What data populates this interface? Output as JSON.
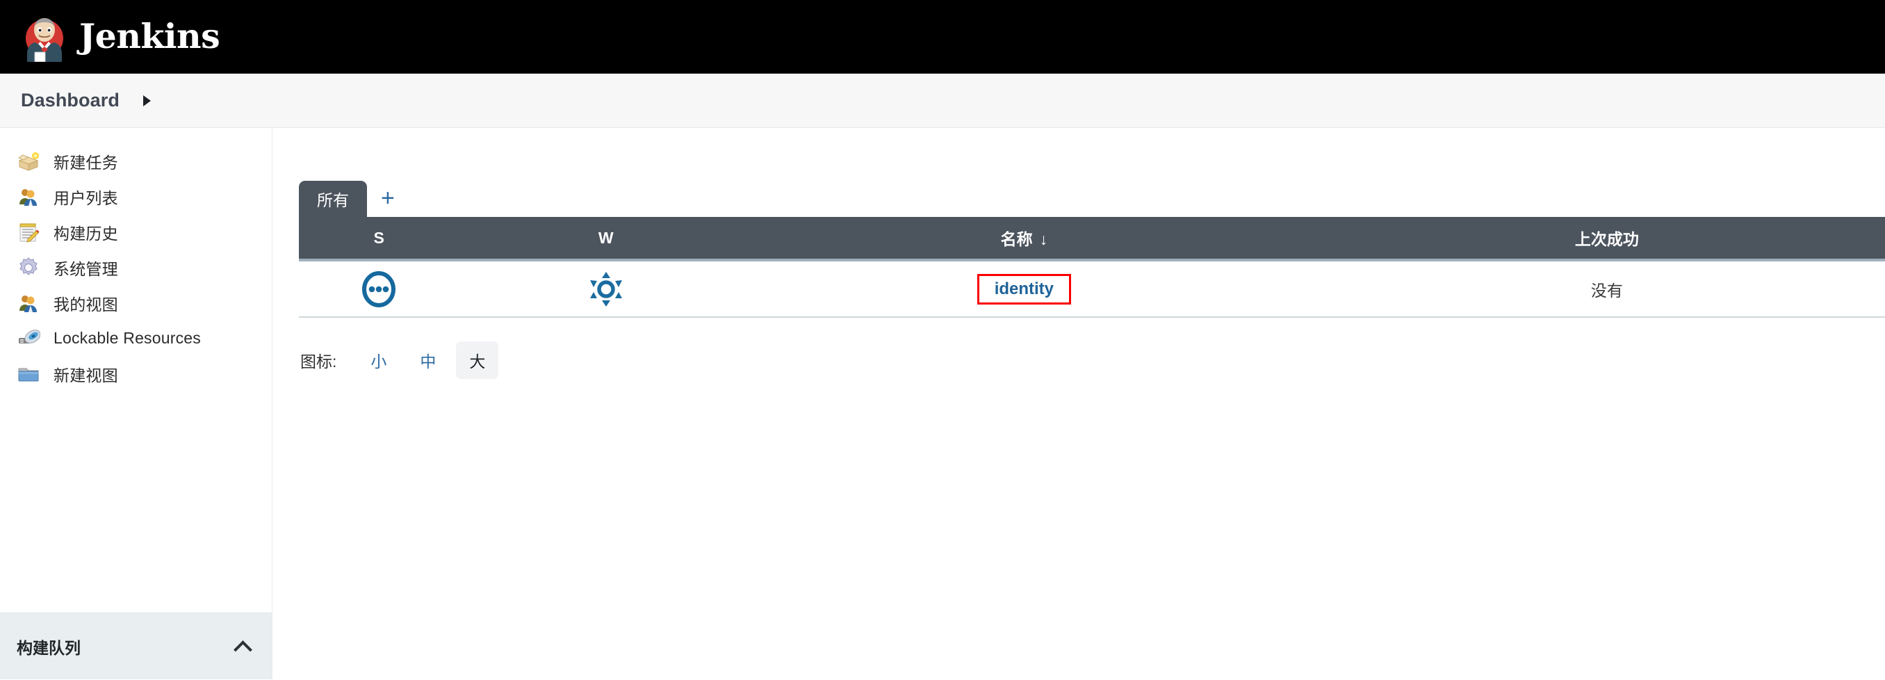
{
  "masthead": {
    "title": "Jenkins",
    "logo_icon": "jenkins-butler-icon"
  },
  "breadcrumb": {
    "items": [
      {
        "label": "Dashboard"
      }
    ],
    "caret_icon": "caret-right-icon"
  },
  "sidebar": {
    "items": [
      {
        "label": "新建任务",
        "icon": "new-job-box-icon"
      },
      {
        "label": "用户列表",
        "icon": "users-icon"
      },
      {
        "label": "构建历史",
        "icon": "build-history-notepad-icon"
      },
      {
        "label": "系统管理",
        "icon": "gear-icon"
      },
      {
        "label": "我的视图",
        "icon": "my-views-people-icon"
      },
      {
        "label": "Lockable Resources",
        "icon": "usb-device-icon"
      },
      {
        "label": "新建视图",
        "icon": "folder-icon"
      }
    ],
    "queue": {
      "title": "构建队列",
      "chevron_icon": "chevron-up-icon"
    }
  },
  "main": {
    "tabs": [
      {
        "label": "所有",
        "active": true
      }
    ],
    "add_tab_label": "+",
    "table": {
      "columns": [
        {
          "key": "s",
          "label": "S"
        },
        {
          "key": "w",
          "label": "W"
        },
        {
          "key": "name",
          "label": "名称",
          "sort_indicator": "↓"
        },
        {
          "key": "last_success",
          "label": "上次成功"
        }
      ],
      "rows": [
        {
          "status_icon": "status-pending-dots-icon",
          "weather_icon": "weather-sunny-icon",
          "name": "identity",
          "name_highlighted": true,
          "last_success": "没有"
        }
      ]
    },
    "icon_size": {
      "label": "图标:",
      "options": [
        {
          "label": "小",
          "active": false
        },
        {
          "label": "中",
          "active": false
        },
        {
          "label": "大",
          "active": true
        }
      ]
    }
  },
  "colors": {
    "masthead_bg": "#000000",
    "table_header_bg": "#4c545e",
    "link_blue": "#1f6399",
    "highlight_red": "#fc0000",
    "queue_bg": "#e9eff1"
  }
}
